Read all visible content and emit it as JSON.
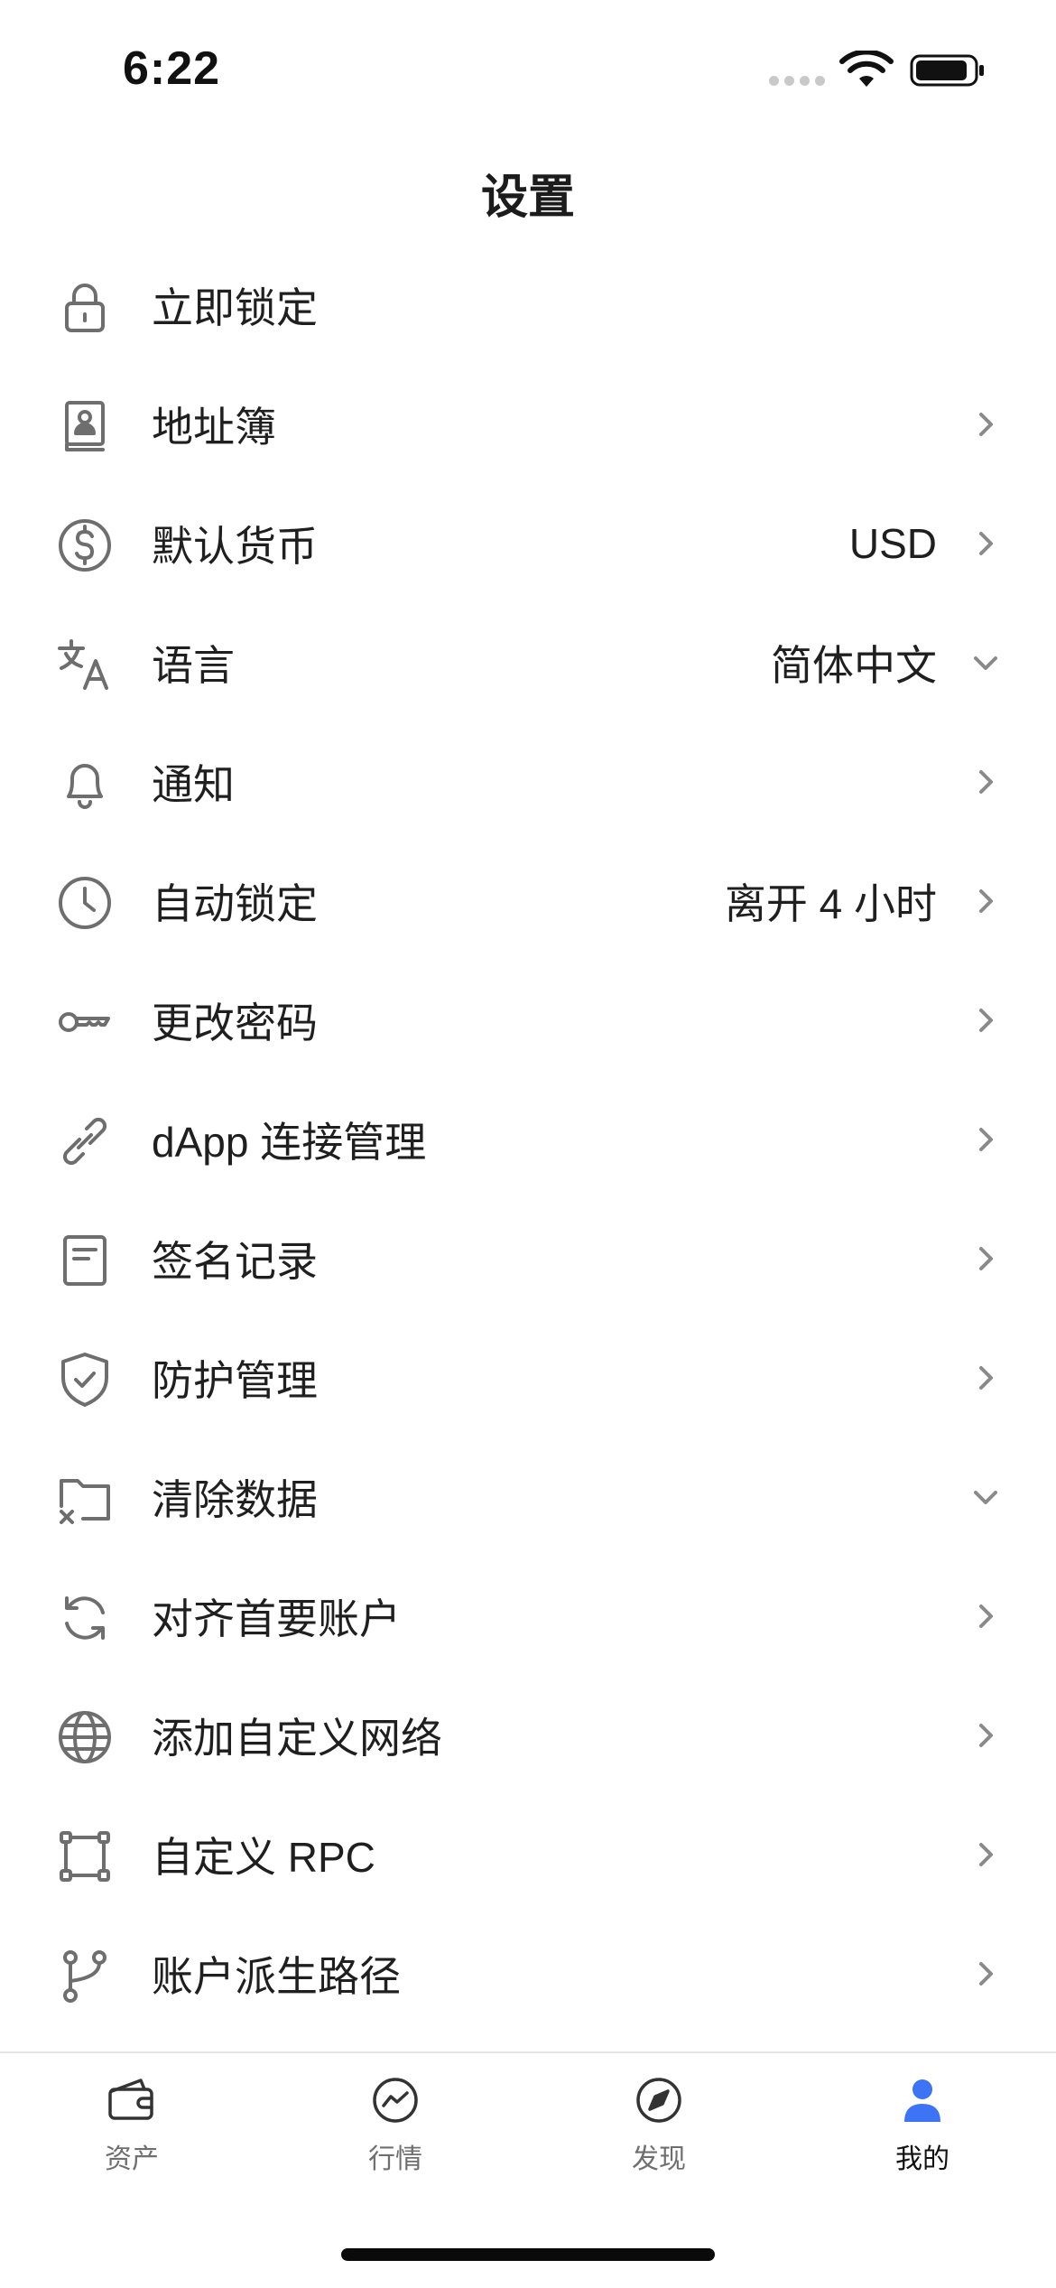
{
  "status": {
    "time": "6:22"
  },
  "nav": {
    "title": "设置"
  },
  "settings": {
    "items": [
      {
        "label": "立即锁定",
        "value": "",
        "icon": "lock-icon"
      },
      {
        "label": "地址簿",
        "value": "",
        "icon": "address-book-icon"
      },
      {
        "label": "默认货币",
        "value": "USD",
        "icon": "dollar-circle-icon"
      },
      {
        "label": "语言",
        "value": "简体中文",
        "icon": "translate-icon"
      },
      {
        "label": "通知",
        "value": "",
        "icon": "bell-icon"
      },
      {
        "label": "自动锁定",
        "value": "离开 4 小时",
        "icon": "clock-icon"
      },
      {
        "label": "更改密码",
        "value": "",
        "icon": "key-icon"
      },
      {
        "label": "dApp 连接管理",
        "value": "",
        "icon": "link-icon"
      },
      {
        "label": "签名记录",
        "value": "",
        "icon": "document-icon"
      },
      {
        "label": "防护管理",
        "value": "",
        "icon": "shield-check-icon"
      },
      {
        "label": "清除数据",
        "value": "",
        "icon": "folder-x-icon"
      },
      {
        "label": "对齐首要账户",
        "value": "",
        "icon": "refresh-icon"
      },
      {
        "label": "添加自定义网络",
        "value": "",
        "icon": "globe-icon"
      },
      {
        "label": "自定义 RPC",
        "value": "",
        "icon": "nodes-square-icon"
      },
      {
        "label": "账户派生路径",
        "value": "",
        "icon": "branch-icon"
      }
    ]
  },
  "tabs": [
    {
      "label": "资产",
      "icon": "wallet-icon",
      "active": false
    },
    {
      "label": "行情",
      "icon": "market-chart-icon",
      "active": false
    },
    {
      "label": "发现",
      "icon": "compass-icon",
      "active": false
    },
    {
      "label": "我的",
      "icon": "user-icon",
      "active": true
    }
  ],
  "colors": {
    "icon_gray": "#6e6e6e",
    "chevron_gray": "#8a8a8a",
    "accent": "#3d73f5"
  }
}
